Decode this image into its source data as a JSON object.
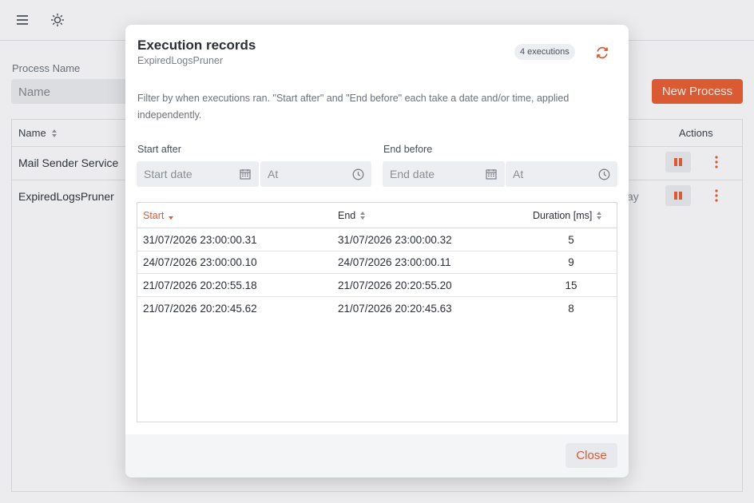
{
  "background": {
    "filter_label": "Process Name",
    "filter_placeholder": "Name",
    "new_process_label": "New Process",
    "table": {
      "col_name": "Name",
      "col_actions": "Actions",
      "rows": [
        {
          "name": "Mail Sender Service",
          "partial": ""
        },
        {
          "name": "ExpiredLogsPruner",
          "partial": "ay"
        }
      ]
    }
  },
  "modal": {
    "title": "Execution records",
    "subtitle": "ExpiredLogsPruner",
    "count_badge": "4 executions",
    "description": "Filter by when executions ran. \"Start after\" and \"End before\" each take a date and/or time, applied independently.",
    "start_after": {
      "label": "Start after",
      "date_placeholder": "Start date",
      "time_placeholder": "At"
    },
    "end_before": {
      "label": "End before",
      "date_placeholder": "End date",
      "time_placeholder": "At"
    },
    "columns": {
      "start": "Start",
      "end": "End",
      "duration": "Duration [ms]"
    },
    "records": [
      {
        "start": "31/07/2026 23:00:00.31",
        "end": "31/07/2026 23:00:00.32",
        "duration": "5"
      },
      {
        "start": "24/07/2026 23:00:00.10",
        "end": "24/07/2026 23:00:00.11",
        "duration": "9"
      },
      {
        "start": "21/07/2026 20:20:55.18",
        "end": "21/07/2026 20:20:55.20",
        "duration": "15"
      },
      {
        "start": "21/07/2026 20:20:45.62",
        "end": "21/07/2026 20:20:45.63",
        "duration": "8"
      }
    ],
    "close_label": "Close"
  },
  "colors": {
    "accent": "#d95a33",
    "overlay": "#ececee"
  }
}
